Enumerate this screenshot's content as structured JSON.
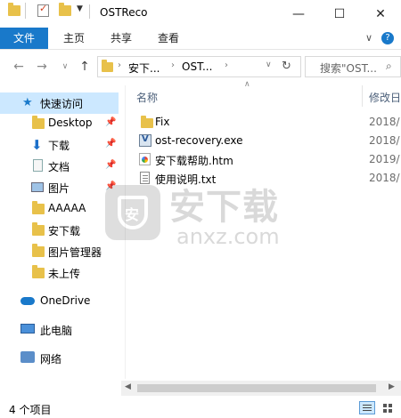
{
  "window": {
    "title": "OSTReco"
  },
  "ribbon": {
    "tabs": [
      "文件",
      "主页",
      "共享",
      "查看"
    ]
  },
  "address": {
    "crumbs": [
      "安下...",
      "OST..."
    ]
  },
  "search": {
    "placeholder": "搜索\"OST..."
  },
  "nav": {
    "quick_access": "快速访问",
    "items": [
      {
        "label": "Desktop",
        "icon": "folder-icon",
        "pinned": true
      },
      {
        "label": "下载",
        "icon": "download-icon",
        "pinned": true
      },
      {
        "label": "文档",
        "icon": "document-icon",
        "pinned": true
      },
      {
        "label": "图片",
        "icon": "picture-icon",
        "pinned": true
      },
      {
        "label": "AAAAA",
        "icon": "folder-icon",
        "pinned": false
      },
      {
        "label": "安下载",
        "icon": "folder-icon",
        "pinned": false
      },
      {
        "label": "图片管理器",
        "icon": "folder-icon",
        "pinned": false
      },
      {
        "label": "未上传",
        "icon": "folder-icon",
        "pinned": false
      }
    ],
    "onedrive": "OneDrive",
    "this_pc": "此电脑",
    "network": "网络"
  },
  "columns": {
    "name": "名称",
    "date": "修改日"
  },
  "files": [
    {
      "name": "Fix",
      "date": "2018/",
      "icon": "folder-icon"
    },
    {
      "name": "ost-recovery.exe",
      "date": "2018/",
      "icon": "exe-icon"
    },
    {
      "name": "安下载帮助.htm",
      "date": "2019/",
      "icon": "htm-icon"
    },
    {
      "name": "使用说明.txt",
      "date": "2018/",
      "icon": "txt-icon"
    }
  ],
  "status": {
    "count": "4 个项目"
  },
  "watermark": {
    "text": "安下载",
    "sub": "anxz.com"
  },
  "colors": {
    "accent": "#1979ca",
    "folder": "#e8c14a",
    "selected": "#cce8ff"
  }
}
